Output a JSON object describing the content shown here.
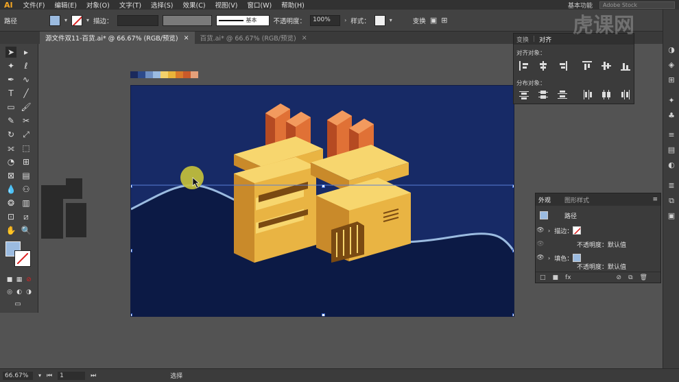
{
  "app": {
    "logo": "AI"
  },
  "menu": [
    "文件(F)",
    "编辑(E)",
    "对象(O)",
    "文字(T)",
    "选择(S)",
    "效果(C)",
    "视图(V)",
    "窗口(W)",
    "帮助(H)"
  ],
  "workspace": {
    "label": "基本功能",
    "search_placeholder": "Adobe Stock"
  },
  "control": {
    "object_type": "路径",
    "stroke_label": "描边：",
    "stroke_style": "基本",
    "opacity_label": "不透明度：",
    "opacity_value": "100%",
    "style_label": "样式：",
    "transform_label": "变换",
    "fill_color": "#9bbbe0"
  },
  "tabs": [
    {
      "label": "源文件双11-百货.ai* @ 66.67% (RGB/预览)",
      "active": true
    },
    {
      "label": "百货.ai* @ 66.67% (RGB/预览)",
      "active": false
    }
  ],
  "palette_colors": [
    "#1b2a5c",
    "#2d4a8a",
    "#6e8fc2",
    "#9bbbe0",
    "#f3d16b",
    "#e8b43a",
    "#d97b2a",
    "#c95a2a",
    "#e3a07a"
  ],
  "align_panel": {
    "tabs": [
      "变换",
      "对齐"
    ],
    "align_objects_label": "对齐对象：",
    "distribute_objects_label": "分布对象："
  },
  "appearance_panel": {
    "tabs": [
      "外观",
      "图形样式"
    ],
    "object": "路径",
    "stroke_label": "描边：",
    "opacity_label": "不透明度：默认值",
    "fill_label": "填色：",
    "opacity_label_2": "不透明度：默认值"
  },
  "status": {
    "zoom": "66.67%",
    "artboard_num": "1",
    "tool_name": "选择"
  },
  "watermark": "虎课网",
  "colors": {
    "artboard_bg": "#172a66",
    "wave_dark": "#0c1a45",
    "wave_stroke": "#9bbbe0",
    "selection": "#5a7fd6",
    "gold_light": "#f7d66e",
    "gold_mid": "#e9b443",
    "gold_dark": "#c98a2a",
    "orange_top": "#e07136",
    "orange_side": "#b54a22",
    "cursor_highlight": "#c8c33a"
  }
}
